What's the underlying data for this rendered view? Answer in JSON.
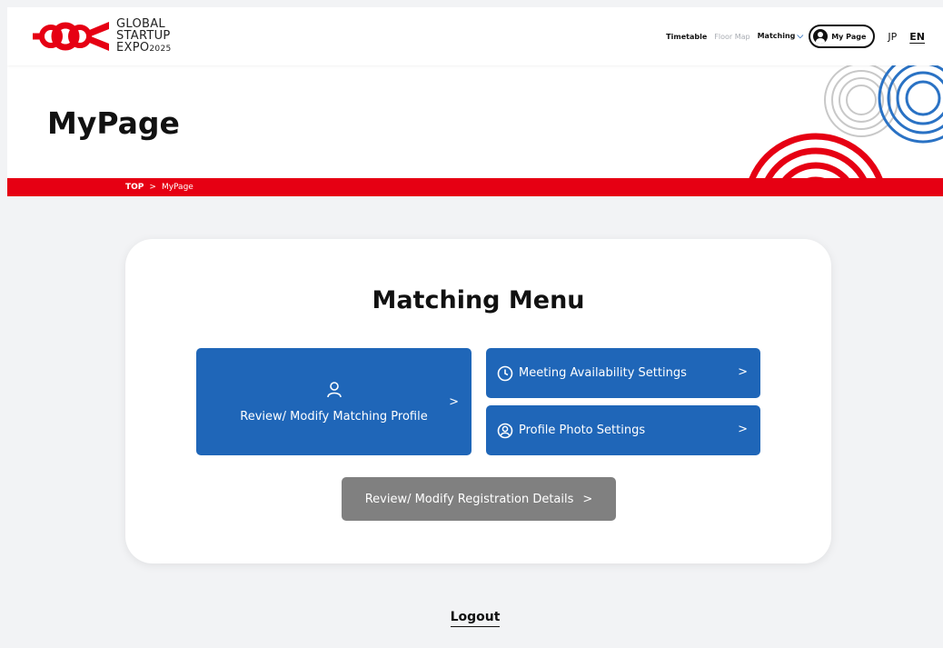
{
  "header": {
    "logo": {
      "line1": "GLOBAL",
      "line2": "STARTUP",
      "line3": "EXPO",
      "year": "2025"
    },
    "nav": {
      "timetable": "Timetable",
      "floor_map": "Floor Map",
      "matching": "Matching",
      "mypage": "My Page",
      "lang_jp": "JP",
      "lang_en": "EN"
    }
  },
  "hero": {
    "title": "MyPage"
  },
  "breadcrumb": {
    "top": "TOP",
    "separator": ">",
    "current": "MyPage"
  },
  "menu": {
    "title": "Matching Menu",
    "profile_button": "Review/ Modify Matching Profile",
    "availability_button": "Meeting Availability Settings",
    "photo_button": "Profile Photo Settings",
    "registration_button": "Review/ Modify Registration Details"
  },
  "footer": {
    "logout": "Logout"
  },
  "colors": {
    "brand_red": "#e60013",
    "button_blue": "#1f66b8",
    "button_gray": "#808080",
    "background": "#f2f3f5"
  }
}
